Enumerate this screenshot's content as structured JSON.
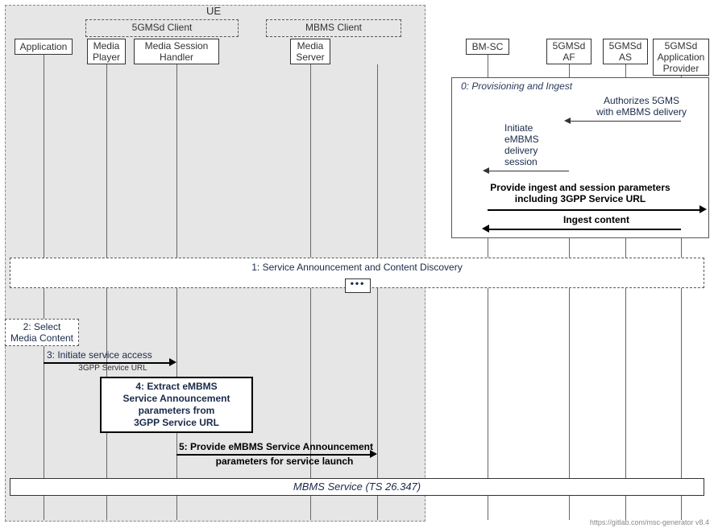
{
  "groups": {
    "ue": "UE",
    "fivegmsd_client": "5GMSd Client",
    "mbms_client": "MBMS Client"
  },
  "participants": {
    "application": "Application",
    "media_player": "Media\nPlayer",
    "media_session_handler": "Media Session\nHandler",
    "media_server": "Media\nServer",
    "bm_sc": "BM-SC",
    "af": "5GMSd\nAF",
    "as": "5GMSd\nAS",
    "provider": "5GMSd\nApplication\nProvider"
  },
  "frames": {
    "provisioning": "0: Provisioning and Ingest"
  },
  "messages": {
    "authorize": "Authorizes 5GMS\nwith eMBMS delivery",
    "initiate_embms": "Initiate\neMBMS\ndelivery\nsession",
    "provide_ingest": "Provide ingest and session parameters\nincluding 3GPP Service URL",
    "ingest_content": "Ingest content",
    "announce": "1: Service Announcement and Content Discovery",
    "select_media": "2: Select\nMedia Content",
    "initiate_access": "3: Initiate service access",
    "initiate_access_sub": "3GPP Service URL",
    "extract": "4: Extract eMBMS\nService Announcement\nparameters from\n3GPP Service URL",
    "provide_params_line1": "5: Provide eMBMS Service Announcement",
    "provide_params_line2": "parameters for service launch",
    "mbms_service": "MBMS Service (TS 26.347)"
  },
  "footer": "https://gitlab.com/msc-generator v8.4"
}
